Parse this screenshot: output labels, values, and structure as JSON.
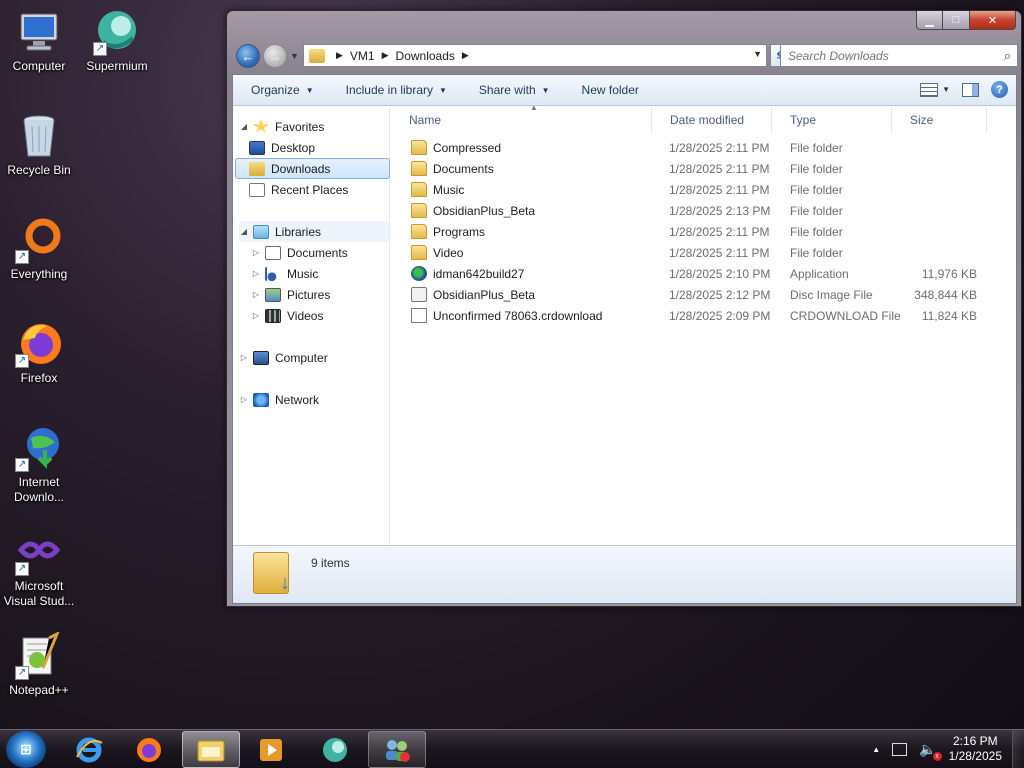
{
  "desktop": {
    "icons": [
      {
        "label": "Computer"
      },
      {
        "label": "Supermium"
      },
      {
        "label": "Recycle Bin"
      },
      {
        "label": "Everything"
      },
      {
        "label": "Firefox"
      },
      {
        "label": "Internet Downlo..."
      },
      {
        "label": "Microsoft Visual Stud..."
      },
      {
        "label": "Notepad++"
      }
    ]
  },
  "window": {
    "address": {
      "crumbs": [
        "VM1",
        "Downloads"
      ]
    },
    "search": {
      "placeholder": "Search Downloads"
    },
    "toolbar": {
      "organize": "Organize",
      "include_in_library": "Include in library",
      "share_with": "Share with",
      "new_folder": "New folder"
    },
    "nav": {
      "favorites": "Favorites",
      "desktop": "Desktop",
      "downloads": "Downloads",
      "recent_places": "Recent Places",
      "libraries": "Libraries",
      "documents": "Documents",
      "music": "Music",
      "pictures": "Pictures",
      "videos": "Videos",
      "computer": "Computer",
      "network": "Network"
    },
    "columns": {
      "name": "Name",
      "date": "Date modified",
      "type": "Type",
      "size": "Size"
    },
    "files": [
      {
        "name": "Compressed",
        "date": "1/28/2025 2:11 PM",
        "type": "File folder",
        "size": "",
        "icon": "folder-icon"
      },
      {
        "name": "Documents",
        "date": "1/28/2025 2:11 PM",
        "type": "File folder",
        "size": "",
        "icon": "folder-icon"
      },
      {
        "name": "Music",
        "date": "1/28/2025 2:11 PM",
        "type": "File folder",
        "size": "",
        "icon": "folder-icon"
      },
      {
        "name": "ObsidianPlus_Beta",
        "date": "1/28/2025 2:13 PM",
        "type": "File folder",
        "size": "",
        "icon": "folder-icon"
      },
      {
        "name": "Programs",
        "date": "1/28/2025 2:11 PM",
        "type": "File folder",
        "size": "",
        "icon": "folder-icon"
      },
      {
        "name": "Video",
        "date": "1/28/2025 2:11 PM",
        "type": "File folder",
        "size": "",
        "icon": "folder-icon"
      },
      {
        "name": "idman642build27",
        "date": "1/28/2025 2:10 PM",
        "type": "Application",
        "size": "11,976 KB",
        "icon": "application-icon"
      },
      {
        "name": "ObsidianPlus_Beta",
        "date": "1/28/2025 2:12 PM",
        "type": "Disc Image File",
        "size": "348,844 KB",
        "icon": "disc-image-icon"
      },
      {
        "name": "Unconfirmed 78063.crdownload",
        "date": "1/28/2025 2:09 PM",
        "type": "CRDOWNLOAD File",
        "size": "11,824 KB",
        "icon": "file-icon"
      }
    ],
    "details": {
      "count": "9 items"
    }
  },
  "taskbar": {
    "clock": {
      "time": "2:16 PM",
      "date": "1/28/2025"
    }
  }
}
